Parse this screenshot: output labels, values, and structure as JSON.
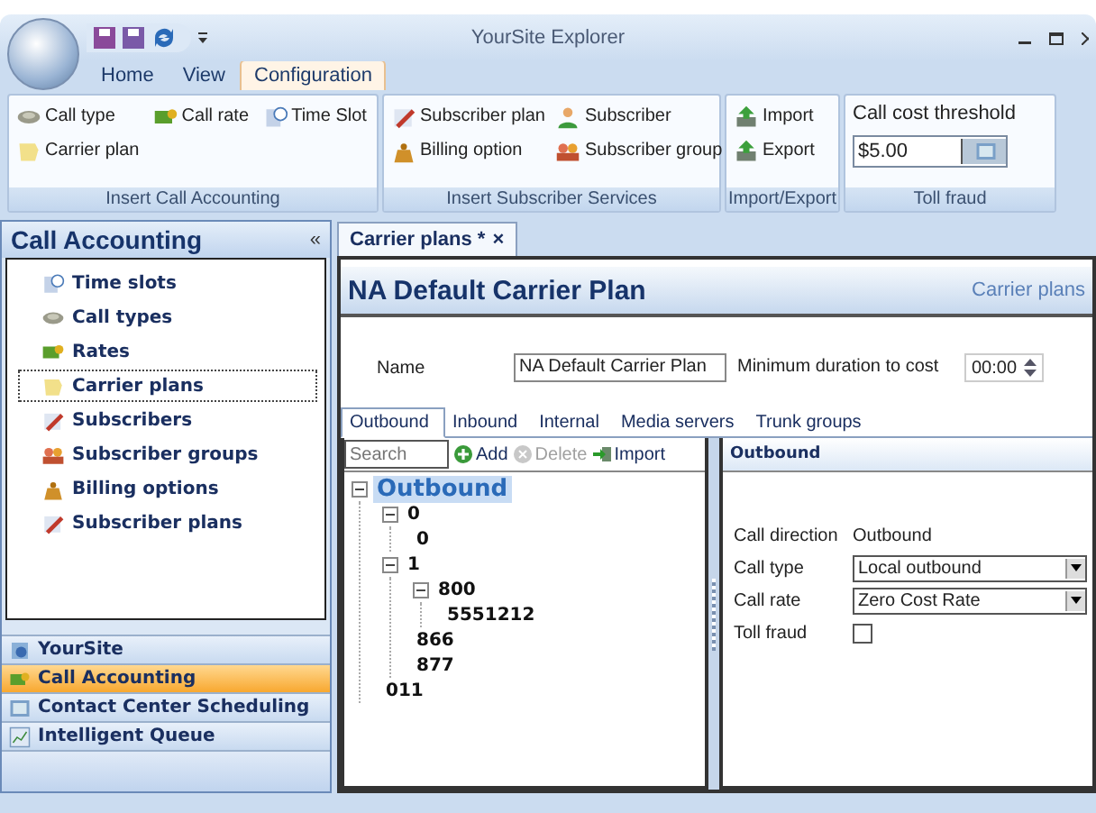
{
  "window": {
    "title": "YourSite Explorer"
  },
  "ribbon": {
    "tabs": [
      {
        "label": "Home",
        "selected": false
      },
      {
        "label": "View",
        "selected": false
      },
      {
        "label": "Configuration",
        "selected": true
      }
    ],
    "groups": [
      {
        "kind": "buttons",
        "label": "Insert Call Accounting",
        "items": [
          {
            "label": "Call type"
          },
          {
            "label": "Call rate"
          },
          {
            "label": "Time Slot"
          },
          {
            "label": "Carrier plan"
          }
        ]
      },
      {
        "kind": "buttons",
        "label": "Insert Subscriber Services",
        "items": [
          {
            "label": "Subscriber plan"
          },
          {
            "label": "Subscriber"
          },
          {
            "label": "Billing option"
          },
          {
            "label": "Subscriber group"
          }
        ]
      },
      {
        "kind": "buttons",
        "label": "Import/Export",
        "items": [
          {
            "label": "Import"
          },
          {
            "label": "Export"
          }
        ]
      },
      {
        "kind": "field",
        "label": "Toll fraud",
        "field_label": "Call cost threshold",
        "value": "$5.00"
      }
    ]
  },
  "nav": {
    "title": "Call Accounting",
    "collapse": "«",
    "items": [
      {
        "label": "Time slots",
        "selected": false
      },
      {
        "label": "Call types",
        "selected": false
      },
      {
        "label": "Rates",
        "selected": false
      },
      {
        "label": "Carrier plans",
        "selected": true
      },
      {
        "label": "Subscribers",
        "selected": false
      },
      {
        "label": "Subscriber groups",
        "selected": false
      },
      {
        "label": "Billing options",
        "selected": false
      },
      {
        "label": "Subscriber plans",
        "selected": false
      }
    ],
    "sections": [
      {
        "label": "YourSite",
        "selected": false
      },
      {
        "label": "Call Accounting",
        "selected": true
      },
      {
        "label": "Contact Center Scheduling",
        "selected": false
      },
      {
        "label": "Intelligent Queue",
        "selected": false
      }
    ]
  },
  "document": {
    "tab": {
      "label": "Carrier plans *",
      "close": "×"
    },
    "title": "NA Default Carrier Plan",
    "subtitle": "Carrier plans",
    "name_label": "Name",
    "name_value": "NA Default Carrier Plan",
    "min_label": "Minimum duration to cost",
    "min_value": "00:00",
    "tabs": [
      {
        "label": "Outbound",
        "selected": true
      },
      {
        "label": "Inbound",
        "selected": false
      },
      {
        "label": "Internal",
        "selected": false
      },
      {
        "label": "Media servers",
        "selected": false
      },
      {
        "label": "Trunk groups",
        "selected": false
      }
    ],
    "search": {
      "placeholder": "Search"
    },
    "actions": [
      {
        "label": "Add",
        "disabled": false
      },
      {
        "label": "Delete",
        "disabled": true
      },
      {
        "label": "Import",
        "disabled": false
      }
    ],
    "tree": [
      {
        "label": "Outbound",
        "selected": true,
        "expanded": true,
        "children": [
          {
            "label": "0",
            "selected": false,
            "expanded": true,
            "children": [
              {
                "label": "0",
                "selected": false
              }
            ]
          },
          {
            "label": "1",
            "selected": false,
            "expanded": true,
            "children": [
              {
                "label": "800",
                "selected": false,
                "expanded": true,
                "children": [
                  {
                    "label": "5551212",
                    "selected": false
                  }
                ]
              },
              {
                "label": "866",
                "selected": false
              },
              {
                "label": "877",
                "selected": false
              }
            ]
          },
          {
            "label": "011",
            "selected": false
          }
        ]
      }
    ],
    "details": {
      "title": "Outbound",
      "rows": [
        {
          "kind": "text",
          "label": "Call direction",
          "value": "Outbound"
        },
        {
          "kind": "select",
          "label": "Call type",
          "value": "Local outbound"
        },
        {
          "kind": "select",
          "label": "Call rate",
          "value": "Zero Cost Rate"
        },
        {
          "kind": "checkbox",
          "label": "Toll fraud",
          "checked": false
        }
      ]
    }
  }
}
